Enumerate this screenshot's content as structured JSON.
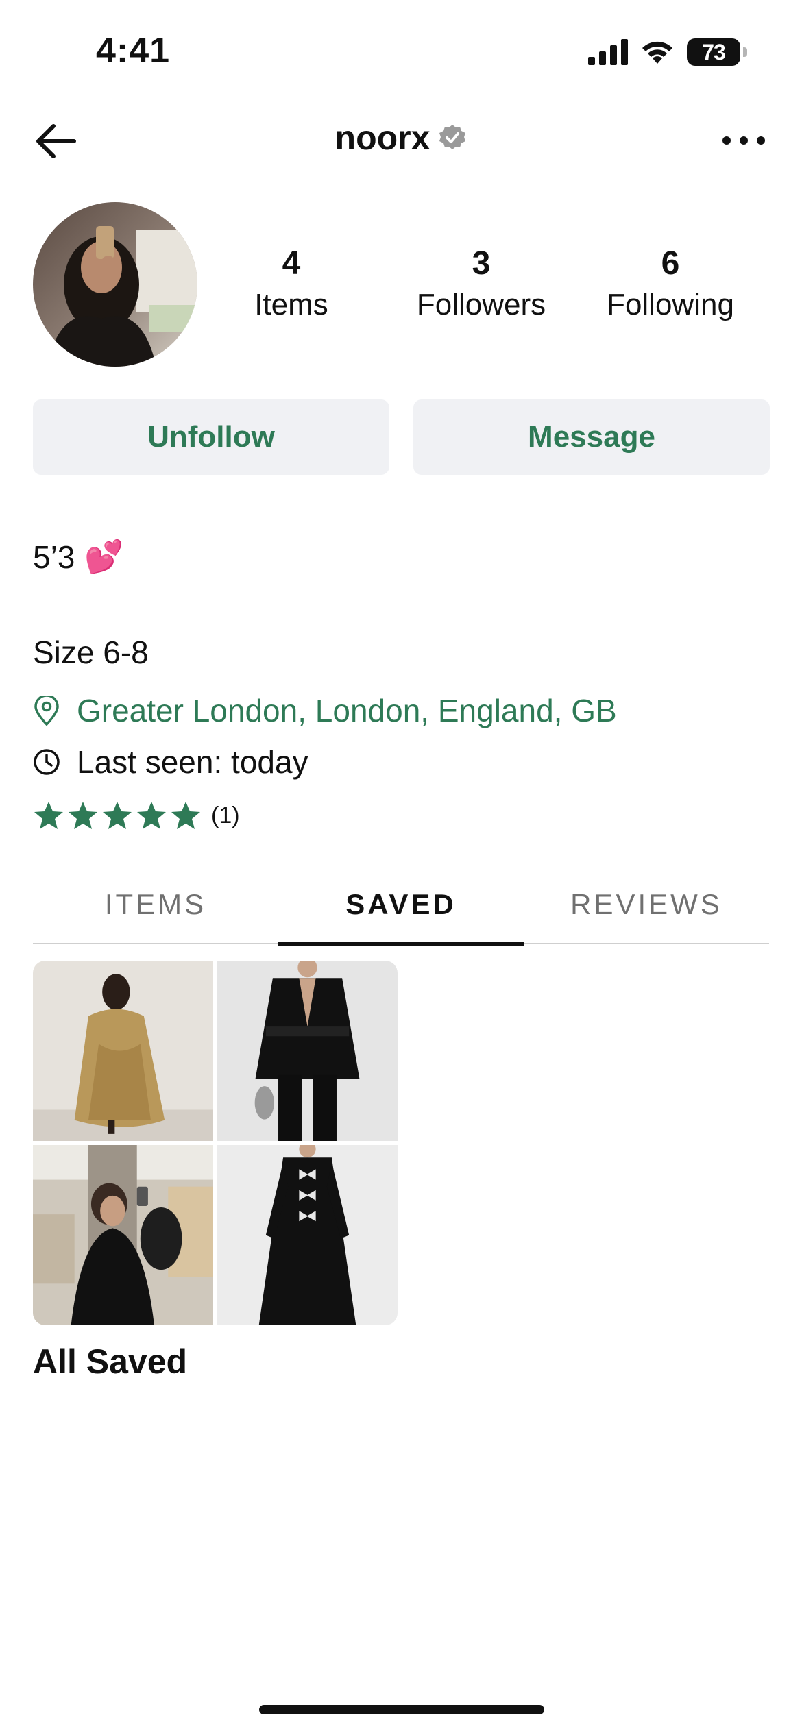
{
  "status_bar": {
    "time": "4:41",
    "battery": "73"
  },
  "header": {
    "title": "noorx",
    "verified": true
  },
  "stats": [
    {
      "value": "4",
      "label": "Items"
    },
    {
      "value": "3",
      "label": "Followers"
    },
    {
      "value": "6",
      "label": "Following"
    }
  ],
  "actions": {
    "unfollow": "Unfollow",
    "message": "Message"
  },
  "bio": {
    "height": "5’3",
    "height_emoji": "💕",
    "size": "Size 6-8"
  },
  "location": "Greater London, London, England, GB",
  "last_seen": "Last seen:  today",
  "rating": {
    "stars": 5,
    "count": "(1)"
  },
  "tabs": [
    {
      "label": "ITEMS",
      "active": false
    },
    {
      "label": "SAVED",
      "active": true
    },
    {
      "label": "REVIEWS",
      "active": false
    }
  ],
  "collection": {
    "title": "All Saved",
    "item_count": 4
  },
  "colors": {
    "accent": "#2e7a56",
    "button_bg": "#f0f1f4",
    "text": "#111111"
  }
}
